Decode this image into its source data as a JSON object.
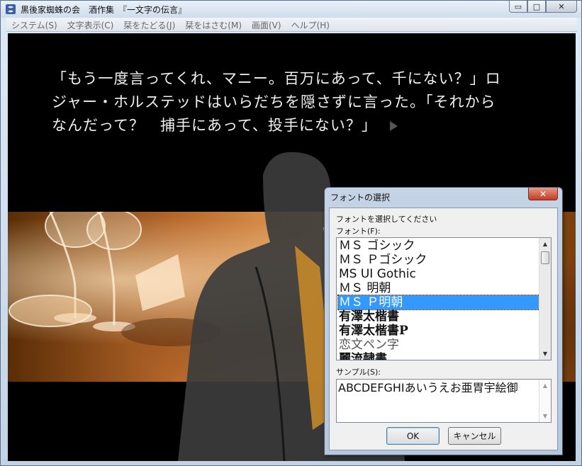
{
  "window": {
    "title": "黒後家蜘蛛の会　酒作集　『一文字の伝言』",
    "minimize_glyph": "▭",
    "maximize_glyph": "□",
    "close_glyph": "✕"
  },
  "menu": [
    {
      "label": "システム(S)"
    },
    {
      "label": "文字表示(C)"
    },
    {
      "label": "栞をたどる(J)"
    },
    {
      "label": "栞をはさむ(M)"
    },
    {
      "label": "画面(V)"
    },
    {
      "label": "ヘルプ(H)"
    }
  ],
  "story": {
    "line1": "「もう一度言ってくれ、マニー。百万にあって、千にない？」ロ",
    "line2": "ジャー・ホルステッドはいらだちを隠さずに言った。「それから",
    "line3": "なんだって？　捕手にあって、投手にない？」"
  },
  "font_dialog": {
    "title": "フォントの選択",
    "close_glyph": "✕",
    "instruction": "フォントを選択してください",
    "font_label": "フォント(F):",
    "fonts": [
      {
        "name": "ＭＳ ゴシック",
        "style": "normal"
      },
      {
        "name": "ＭＳ Ｐゴシック",
        "style": "normal"
      },
      {
        "name": "MS UI Gothic",
        "style": "normal"
      },
      {
        "name": "ＭＳ 明朝",
        "style": "normal"
      },
      {
        "name": "ＭＳ Ｐ明朝",
        "style": "selected"
      },
      {
        "name": "有澤太楷書",
        "style": "bold"
      },
      {
        "name": "有澤太楷書P",
        "style": "bold"
      },
      {
        "name": "恋文ペン字",
        "style": "script"
      },
      {
        "name": "麗流隷書",
        "style": "bold"
      }
    ],
    "selected_font": "ＭＳ Ｐ明朝",
    "sample_label": "サンプル(S):",
    "sample_text": "ABCDEFGHIあいうえお亜胃宇絵御",
    "ok_label": "OK",
    "cancel_label": "キャンセル",
    "scroll_up_glyph": "▲",
    "scroll_down_glyph": "▼"
  },
  "colors": {
    "selection": "#3399ff",
    "screen_bg": "#000000",
    "photo_tone": "#d08a3e"
  }
}
